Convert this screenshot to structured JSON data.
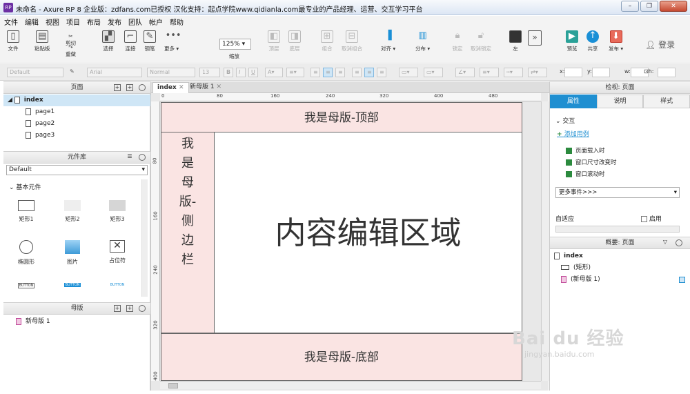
{
  "window": {
    "title": "未命名 - Axure RP 8 企业版：zdfans.com已授权 汉化支持：起点学院www.qidianla.com最专业的产品经理、运营、交互学习平台",
    "app_icon": "RP"
  },
  "menu": [
    "文件",
    "编辑",
    "视图",
    "项目",
    "布局",
    "发布",
    "团队",
    "帐户",
    "帮助"
  ],
  "toolbar": {
    "file": "文件",
    "paste": "粘贴板",
    "cut": "剪切",
    "copy": "",
    "redo": "重做",
    "select": "选择",
    "connect": "连接",
    "pen": "钢笔",
    "more": "更多 ▾",
    "zoom_value": "125%",
    "zoom_label": "缩放",
    "top": "顶层",
    "bottom": "底层",
    "group": "组合",
    "ungroup": "取消组合",
    "align": "对齐 ▾",
    "distribute": "分布 ▾",
    "lock": "锁定",
    "unlock": "取消锁定",
    "left": "左",
    "preview": "预览",
    "share": "共享",
    "publish": "发布 ▾",
    "login": "登录"
  },
  "format": {
    "style": "Default",
    "font": "Arial",
    "weight": "Normal",
    "size": "13",
    "x_label": "x:",
    "y_label": "y:",
    "w_label": "w:",
    "h_label": "h:"
  },
  "pages_panel": {
    "title": "页面",
    "items": [
      "index",
      "page1",
      "page2",
      "page3"
    ]
  },
  "library_panel": {
    "title": "元件库",
    "selected": "Default",
    "group": "基本元件",
    "widgets": [
      "矩形1",
      "矩形2",
      "矩形3",
      "椭圆形",
      "图片",
      "占位符",
      "BUTTON",
      "BUTTON",
      "BUTTON"
    ]
  },
  "masters_panel": {
    "title": "母版",
    "items": [
      "新母版 1"
    ]
  },
  "canvas": {
    "tabs": [
      "index",
      "新母版 1"
    ],
    "ruler_top": [
      "0",
      "80",
      "160",
      "240",
      "320",
      "400",
      "480"
    ],
    "ruler_left": [
      "80",
      "160",
      "240",
      "320",
      "400"
    ],
    "header_text": "我是母版-顶部",
    "sidebar_text": "我是母版-侧边栏",
    "content_text": "内容编辑区域",
    "footer_text": "我是母版-底部"
  },
  "inspector": {
    "title": "检视: 页面",
    "tabs": [
      "属性",
      "说明",
      "样式"
    ],
    "interaction": "交互",
    "add_case": "添加用例",
    "events": [
      "页面载入时",
      "窗口尺寸改变时",
      "窗口滚动时"
    ],
    "more_events": "更多事件>>>",
    "adaptive": "自适应",
    "enable": "启用"
  },
  "outline": {
    "title": "概要: 页面",
    "items": [
      "index",
      "(矩形)",
      "(新母版 1)"
    ]
  },
  "watermark": {
    "brand": "Bai du 经验",
    "url": "jingyan.baidu.com"
  }
}
